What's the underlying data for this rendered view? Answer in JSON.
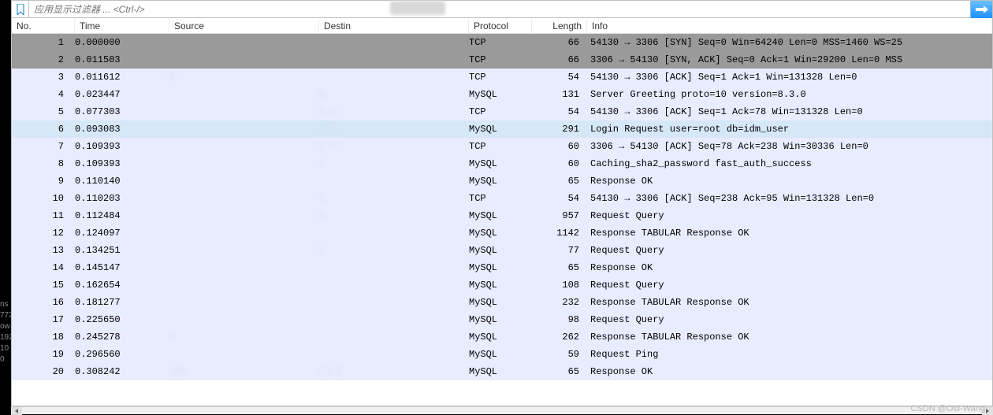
{
  "filter": {
    "placeholder": "应用显示过滤器 ... <Ctrl-/>"
  },
  "columns": {
    "no": "No.",
    "time": "Time",
    "source": "Source",
    "destination": "Destin",
    "protocol": "Protocol",
    "length": "Length",
    "info": "Info"
  },
  "packets": [
    {
      "no": "1",
      "time": "0.000000",
      "src": "",
      "dst": "",
      "proto": "TCP",
      "len": "66",
      "info": "54130 → 3306 [SYN] Seq=0 Win=64240 Len=0 MSS=1460 WS=25",
      "style": "dark"
    },
    {
      "no": "2",
      "time": "0.011503",
      "src": "",
      "dst": "",
      "proto": "TCP",
      "len": "66",
      "info": "3306 → 54130 [SYN, ACK] Seq=0 Ack=1 Win=29200 Len=0 MSS",
      "style": "dark"
    },
    {
      "no": "3",
      "time": "0.011612",
      "src": "5.",
      "dst": "",
      "proto": "TCP",
      "len": "54",
      "info": "54130 → 3306 [ACK] Seq=1 Ack=1 Win=131328 Len=0",
      "style": "tcp"
    },
    {
      "no": "4",
      "time": "0.023447",
      "src": "",
      "dst": "0",
      "proto": "MySQL",
      "len": "131",
      "info": "Server Greeting  proto=10 version=8.3.0",
      "style": "tcp"
    },
    {
      "no": "5",
      "time": "0.077303",
      "src": "",
      "dst": "1     1",
      "proto": "TCP",
      "len": "54",
      "info": "54130 → 3306 [ACK] Seq=1 Ack=78 Win=131328 Len=0",
      "style": "tcp"
    },
    {
      "no": "6",
      "time": "0.093083",
      "src": "",
      "dst": "1      1",
      "proto": "MySQL",
      "len": "291",
      "info": "Login Request user=root db=idm_user",
      "style": "sel"
    },
    {
      "no": "7",
      "time": "0.109393",
      "src": "",
      "dst": "1      7",
      "proto": "TCP",
      "len": "60",
      "info": "3306 → 54130 [ACK] Seq=78 Ack=238 Win=30336 Len=0",
      "style": "tcp"
    },
    {
      "no": "8",
      "time": "0.109393",
      "src": "",
      "dst": "7",
      "proto": "MySQL",
      "len": "60",
      "info": "Caching_sha2_password fast_auth_success",
      "style": "tcp"
    },
    {
      "no": "9",
      "time": "0.110140",
      "src": "",
      "dst": "",
      "proto": "MySQL",
      "len": "65",
      "info": "Response  OK",
      "style": "tcp"
    },
    {
      "no": "10",
      "time": "0.110203",
      "src": "",
      "dst": "1",
      "proto": "TCP",
      "len": "54",
      "info": "54130 → 3306 [ACK] Seq=238 Ack=95 Win=131328 Len=0",
      "style": "tcp"
    },
    {
      "no": "11",
      "time": "0.112484",
      "src": "",
      "dst": "1",
      "proto": "MySQL",
      "len": "957",
      "info": "Request Query",
      "style": "tcp"
    },
    {
      "no": "12",
      "time": "0.124097",
      "src": "",
      "dst": "",
      "proto": "MySQL",
      "len": "1142",
      "info": "Response TABULAR Response  OK",
      "style": "tcp"
    },
    {
      "no": "13",
      "time": "0.134251",
      "src": "",
      "dst": "1",
      "proto": "MySQL",
      "len": "77",
      "info": "Request Query",
      "style": "tcp"
    },
    {
      "no": "14",
      "time": "0.145147",
      "src": "",
      "dst": "",
      "proto": "MySQL",
      "len": "65",
      "info": "Response  OK",
      "style": "tcp"
    },
    {
      "no": "15",
      "time": "0.162654",
      "src": "",
      "dst": "",
      "proto": "MySQL",
      "len": "108",
      "info": "Request Query",
      "style": "tcp"
    },
    {
      "no": "16",
      "time": "0.181277",
      "src": "",
      "dst": "",
      "proto": "MySQL",
      "len": "232",
      "info": "Response TABULAR Response  OK",
      "style": "tcp"
    },
    {
      "no": "17",
      "time": "0.225650",
      "src": "",
      "dst": "",
      "proto": "MySQL",
      "len": "98",
      "info": "Request Query",
      "style": "tcp"
    },
    {
      "no": "18",
      "time": "0.245278",
      "src": "1",
      "dst": "",
      "proto": "MySQL",
      "len": "262",
      "info": "Response TABULAR Response  OK",
      "style": "tcp"
    },
    {
      "no": "19",
      "time": "0.296560",
      "src": "",
      "dst": "",
      "proto": "MySQL",
      "len": "59",
      "info": "Request Ping",
      "style": "tcp"
    },
    {
      "no": "20",
      "time": "0.308242",
      "src": "101",
      "dst": "10.6",
      "proto": "MySQL",
      "len": "65",
      "info": "Response  OK",
      "style": "tcp"
    }
  ],
  "left_gutter": [
    "ns",
    "",
    "772",
    "ow",
    "192",
    "10",
    "",
    " 0"
  ],
  "watermark": "CSDN @Old-Wang"
}
